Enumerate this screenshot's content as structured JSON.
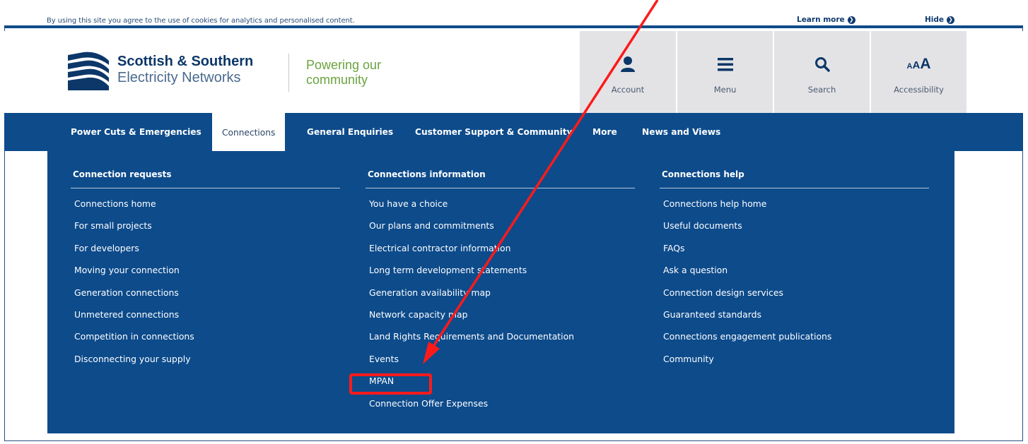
{
  "cookie_bar": {
    "text": "By using this site you agree to the use of cookies for analytics and personalised content.",
    "learn_more": "Learn more",
    "hide": "Hide"
  },
  "brand": {
    "name_line1": "Scottish & Southern",
    "name_line2": "Electricity Networks",
    "tagline_line1": "Powering our",
    "tagline_line2": "community"
  },
  "utility": {
    "account": "Account",
    "menu": "Menu",
    "search": "Search",
    "accessibility": "Accessibility",
    "accessibility_glyph": "AAA"
  },
  "nav": {
    "items": [
      {
        "label": "Power Cuts & Emergencies"
      },
      {
        "label": "Connections"
      },
      {
        "label": "General Enquiries"
      },
      {
        "label": "Customer Support & Community"
      },
      {
        "label": "More"
      },
      {
        "label": "News and Views"
      }
    ]
  },
  "dropdown": {
    "columns": [
      {
        "heading": "Connection requests",
        "links": [
          "Connections home",
          "For small projects",
          "For developers",
          "Moving your connection",
          "Generation connections",
          "Unmetered connections",
          "Competition in connections",
          "Disconnecting your supply"
        ]
      },
      {
        "heading": "Connections information",
        "links": [
          "You have a choice",
          "Our plans and commitments",
          "Electrical contractor information",
          "Long term development statements",
          "Generation availability map",
          "Network capacity map",
          "Land Rights Requirements and Documentation",
          "Events",
          "MPAN",
          "Connection Offer Expenses"
        ]
      },
      {
        "heading": "Connections help",
        "links": [
          "Connections help home",
          "Useful documents",
          "FAQs",
          "Ask a question",
          "Connection design services",
          "Guaranteed standards",
          "Connections engagement publications",
          "Community"
        ]
      }
    ]
  },
  "colors": {
    "brand_blue": "#0d4b8b",
    "brand_green": "#6aa33f",
    "annotation_red": "#ff1a1a"
  }
}
